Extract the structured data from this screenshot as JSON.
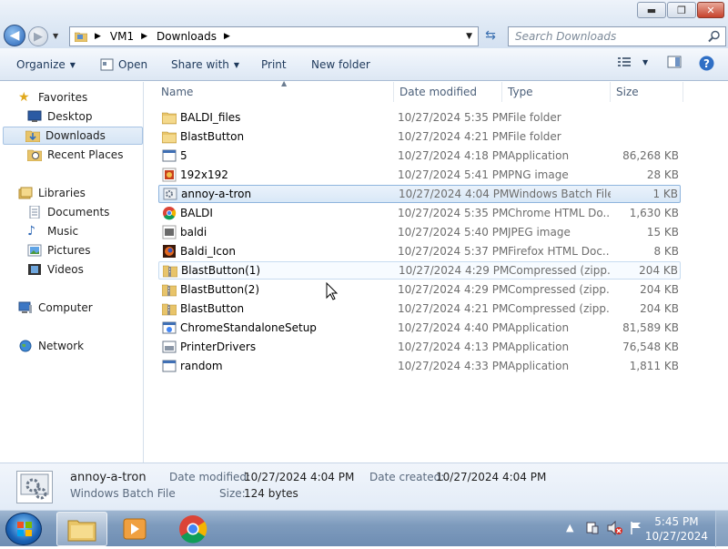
{
  "window": {
    "controls": {
      "minimize": "▬",
      "maximize": "❐",
      "close": "✕"
    }
  },
  "navigation": {
    "breadcrumbs": [
      "VM1",
      "Downloads"
    ],
    "search_placeholder": "Search Downloads"
  },
  "toolbar": {
    "organize": "Organize",
    "open": "Open",
    "share_with": "Share with",
    "print": "Print",
    "new_folder": "New folder"
  },
  "sidebar": {
    "favorites": {
      "label": "Favorites",
      "items": [
        "Desktop",
        "Downloads",
        "Recent Places"
      ]
    },
    "libraries": {
      "label": "Libraries",
      "items": [
        "Documents",
        "Music",
        "Pictures",
        "Videos"
      ]
    },
    "computer": "Computer",
    "network": "Network"
  },
  "columns": {
    "name": "Name",
    "date": "Date modified",
    "type": "Type",
    "size": "Size"
  },
  "files": [
    {
      "name": "BALDI_files",
      "date": "10/27/2024 5:35 PM",
      "type": "File folder",
      "size": "",
      "icon": "folder-icon"
    },
    {
      "name": "BlastButton",
      "date": "10/27/2024 4:21 PM",
      "type": "File folder",
      "size": "",
      "icon": "folder-icon"
    },
    {
      "name": "5",
      "date": "10/27/2024 4:18 PM",
      "type": "Application",
      "size": "86,268 KB",
      "icon": "application-icon"
    },
    {
      "name": "192x192",
      "date": "10/27/2024 5:41 PM",
      "type": "PNG image",
      "size": "28 KB",
      "icon": "png-image-icon"
    },
    {
      "name": "annoy-a-tron",
      "date": "10/27/2024 4:04 PM",
      "type": "Windows Batch File",
      "size": "1 KB",
      "icon": "batch-file-icon"
    },
    {
      "name": "BALDI",
      "date": "10/27/2024 5:35 PM",
      "type": "Chrome HTML Do...",
      "size": "1,630 KB",
      "icon": "chrome-html-icon"
    },
    {
      "name": "baldi",
      "date": "10/27/2024 5:40 PM",
      "type": "JPEG image",
      "size": "15 KB",
      "icon": "jpeg-image-icon"
    },
    {
      "name": "Baldi_Icon",
      "date": "10/27/2024 5:37 PM",
      "type": "Firefox HTML Doc...",
      "size": "8 KB",
      "icon": "firefox-html-icon"
    },
    {
      "name": "BlastButton(1)",
      "date": "10/27/2024 4:29 PM",
      "type": "Compressed (zipp...",
      "size": "204 KB",
      "icon": "zip-folder-icon"
    },
    {
      "name": "BlastButton(2)",
      "date": "10/27/2024 4:29 PM",
      "type": "Compressed (zipp...",
      "size": "204 KB",
      "icon": "zip-folder-icon"
    },
    {
      "name": "BlastButton",
      "date": "10/27/2024 4:21 PM",
      "type": "Compressed (zipp...",
      "size": "204 KB",
      "icon": "zip-folder-icon"
    },
    {
      "name": "ChromeStandaloneSetup",
      "date": "10/27/2024 4:40 PM",
      "type": "Application",
      "size": "81,589 KB",
      "icon": "installer-icon"
    },
    {
      "name": "PrinterDrivers",
      "date": "10/27/2024 4:13 PM",
      "type": "Application",
      "size": "76,548 KB",
      "icon": "printer-app-icon"
    },
    {
      "name": "random",
      "date": "10/27/2024 4:33 PM",
      "type": "Application",
      "size": "1,811 KB",
      "icon": "application-icon"
    }
  ],
  "selected_index": 4,
  "details": {
    "name": "annoy-a-tron",
    "type": "Windows Batch File",
    "date_modified_label": "Date modified:",
    "date_modified": "10/27/2024 4:04 PM",
    "date_created_label": "Date created:",
    "date_created": "10/27/2024 4:04 PM",
    "size_label": "Size:",
    "size": "124 bytes"
  },
  "taskbar": {
    "apps": [
      "file-explorer",
      "media-player",
      "chrome"
    ],
    "time": "5:45 PM",
    "date": "10/27/2024"
  },
  "colors": {
    "selection": "#d9e8f7",
    "selection_border": "#8eb4dd",
    "toolbar_text": "#1e395b",
    "taskbar": "#7e9bbd"
  }
}
